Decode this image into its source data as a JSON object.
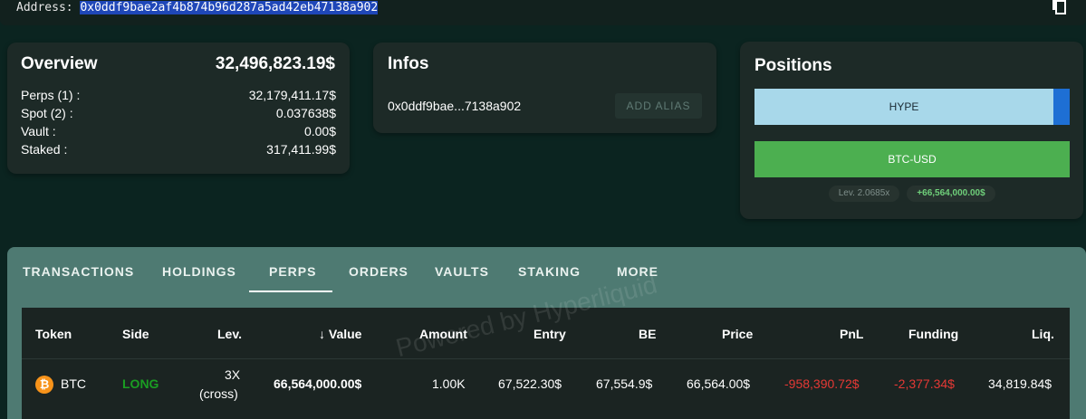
{
  "address": {
    "label": "Address:",
    "value": "0x0ddf9bae2af4b874b96d287a5ad42eb47138a902"
  },
  "overview": {
    "title": "Overview",
    "total": "32,496,823.19$",
    "rows": [
      {
        "label": "Perps (1) :",
        "value": "32,179,411.17$"
      },
      {
        "label": "Spot (2) :",
        "value": "0.037638$"
      },
      {
        "label": "Vault :",
        "value": "0.00$"
      },
      {
        "label": "Staked :",
        "value": "317,411.99$"
      }
    ]
  },
  "infos": {
    "title": "Infos",
    "short_address": "0x0ddf9bae...7138a902",
    "alias_button": "ADD ALIAS"
  },
  "positions": {
    "title": "Positions",
    "bars": [
      {
        "label": "HYPE",
        "color": "#a8d8ea"
      },
      {
        "label": "BTC-USD",
        "color": "#4caf50"
      }
    ],
    "leverage": "Lev. 2.0685x",
    "total_value": "+66,564,000.00$"
  },
  "tabs": [
    "TRANSACTIONS",
    "HOLDINGS",
    "PERPS",
    "ORDERS",
    "VAULTS",
    "STAKING",
    "MORE"
  ],
  "active_tab": "PERPS",
  "table": {
    "headers": [
      "Token",
      "Side",
      "Lev.",
      "Value",
      "Amount",
      "Entry",
      "BE",
      "Price",
      "PnL",
      "Funding",
      "Liq."
    ],
    "sort_indicator": "↓",
    "rows": [
      {
        "token": "BTC",
        "side": "LONG",
        "lev_line1": "3X",
        "lev_line2": "(cross)",
        "value": "66,564,000.00$",
        "amount": "1.00K",
        "entry": "67,522.30$",
        "be": "67,554.9$",
        "price": "66,564.00$",
        "pnl": "-958,390.72$",
        "funding": "-2,377.34$",
        "liq": "34,819.84$"
      }
    ],
    "watermark": "Powered by Hyperliquid"
  },
  "colors": {
    "long": "#1a9e22",
    "negative": "#e53935",
    "btc_icon": "#f7931a"
  }
}
